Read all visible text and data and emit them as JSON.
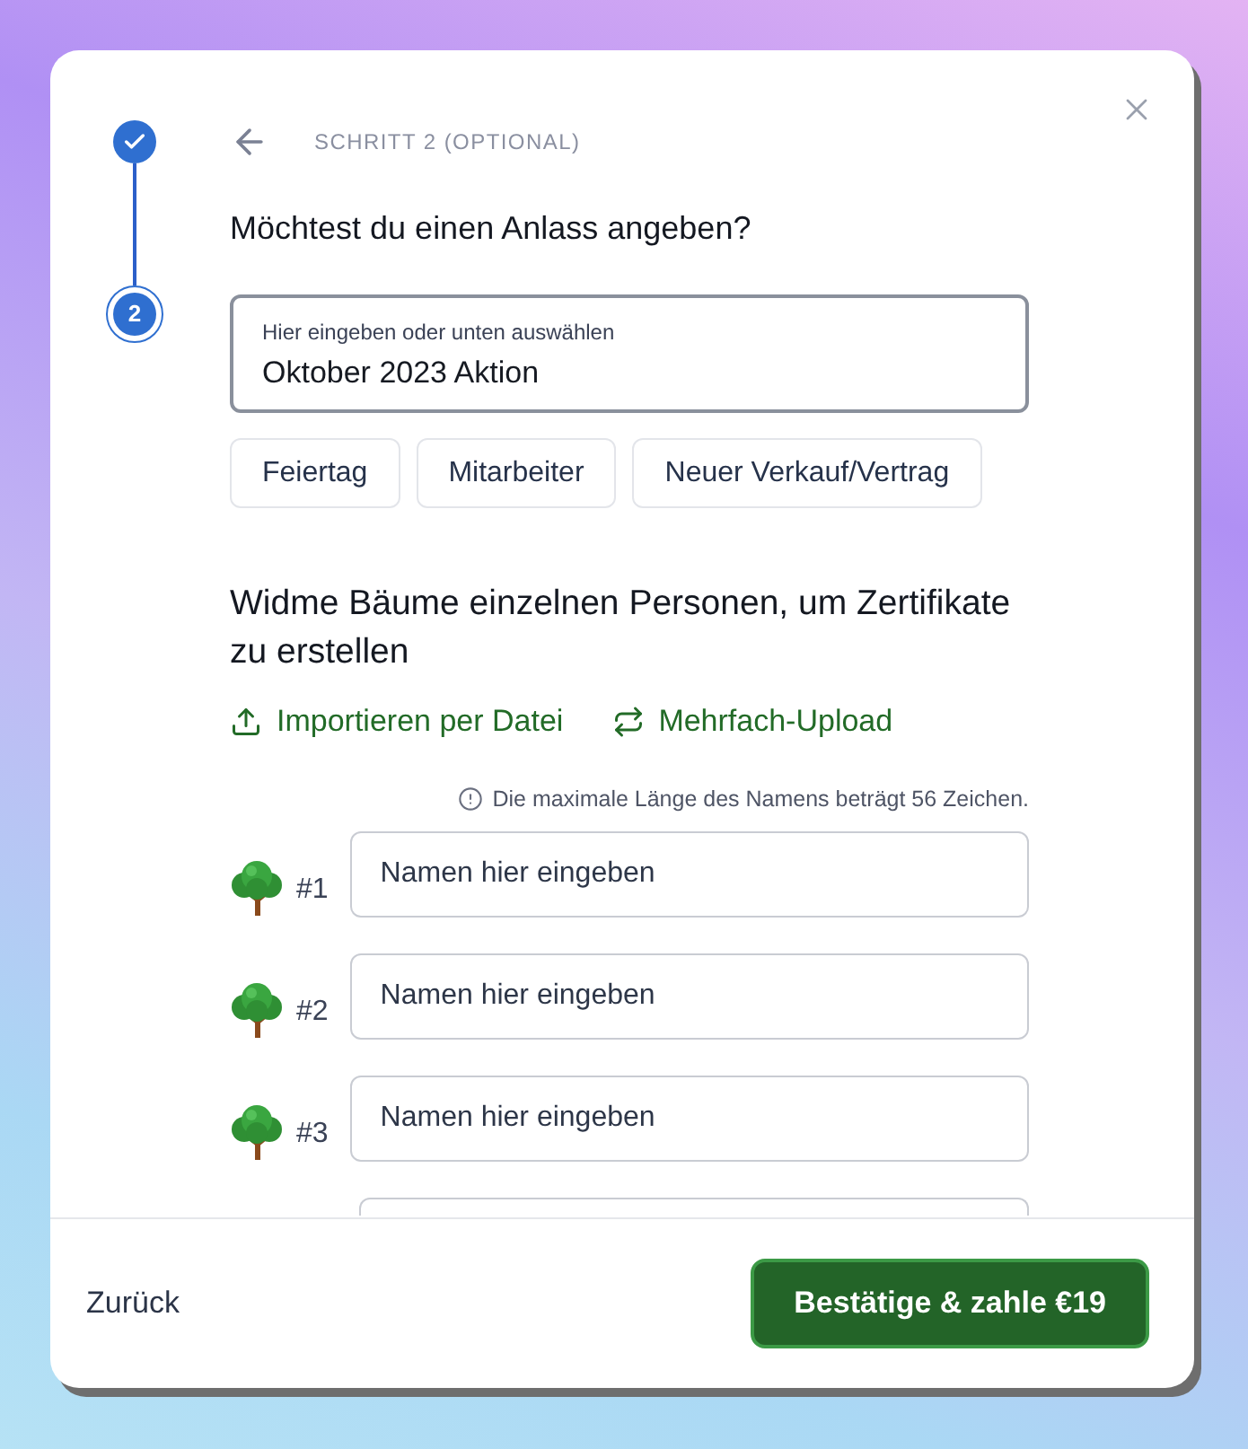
{
  "stepper": [
    {
      "done": true
    },
    {
      "done": false,
      "label": "2"
    }
  ],
  "header": {
    "step_label": "SCHRITT 2 (OPTIONAL)"
  },
  "occasion": {
    "question": "Möchtest du einen Anlass angeben?",
    "field": {
      "label": "Hier eingeben oder unten auswählen",
      "value": "Oktober 2023 Aktion"
    },
    "suggestions": [
      {
        "label": "Feiertag",
        "selected": false
      },
      {
        "label": "Mitarbeiter",
        "selected": false
      },
      {
        "label": "Neuer Verkauf/Vertrag",
        "selected": false
      }
    ]
  },
  "dedication": {
    "title": "Widme Bäume einzelnen Personen, um Zertifikate zu erstellen",
    "actions": [
      {
        "kind": "upload",
        "label": "Importieren per Datei"
      },
      {
        "kind": "repeat",
        "label": "Mehrfach-Upload"
      }
    ],
    "hint": "Die maximale Länge des Namens beträgt 56 Zeichen.",
    "rows": [
      {
        "kind": "full",
        "number": "#1",
        "placeholder": "Namen hier eingeben"
      },
      {
        "kind": "full",
        "number": "#2",
        "placeholder": "Namen hier eingeben"
      },
      {
        "kind": "full",
        "number": "#3",
        "placeholder": "Namen hier eingeben"
      },
      {
        "kind": "cut"
      }
    ]
  },
  "footer": {
    "back": "Zurück",
    "confirm": "Bestätige & zahle €19"
  }
}
